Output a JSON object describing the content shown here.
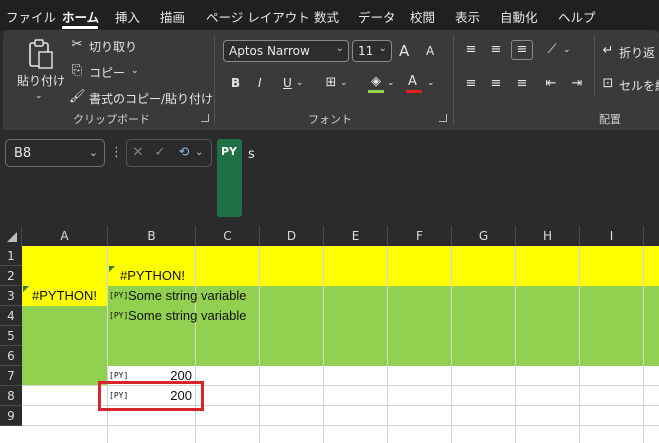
{
  "menu": {
    "tabs": [
      "ファイル",
      "ホーム",
      "挿入",
      "描画",
      "ページ レイアウト",
      "数式",
      "データ",
      "校閲",
      "表示",
      "自動化",
      "ヘルプ"
    ],
    "active": "ホーム"
  },
  "ribbon": {
    "clipboard": {
      "paste_label": "貼り付け",
      "cut_label": "切り取り",
      "copy_label": "コピー",
      "format_painter_label": "書式のコピー/貼り付け",
      "group_label": "クリップボード"
    },
    "font": {
      "font_name": "Aptos Narrow",
      "font_size": "11",
      "bold": "B",
      "italic": "I",
      "underline": "U",
      "font_color_letter": "A",
      "grow_label": "A",
      "shrink_label": "A",
      "group_label": "フォント"
    },
    "alignment": {
      "wrap_label": "折り返",
      "merge_label": "セルを結",
      "group_label": "配置"
    }
  },
  "formula_bar": {
    "name_box": "B8",
    "py_badge": "PY",
    "formula": "s"
  },
  "sheet": {
    "columns": [
      "A",
      "B",
      "C",
      "D",
      "E",
      "F",
      "G",
      "H",
      "I"
    ],
    "rows": [
      "1",
      "2",
      "3",
      "4",
      "5",
      "6",
      "7",
      "8",
      "9"
    ],
    "cells": {
      "B2": "#PYTHON!",
      "A3": "#PYTHON!",
      "B3": "Some string variable",
      "B4": "Some string variable",
      "B7": "200",
      "B8": "200"
    },
    "py_tag": "[PY]",
    "colors": {
      "yellow": "#ffff00",
      "green": "#92d050",
      "highlight": "#d6262b",
      "python_green": "#1f7044"
    }
  }
}
